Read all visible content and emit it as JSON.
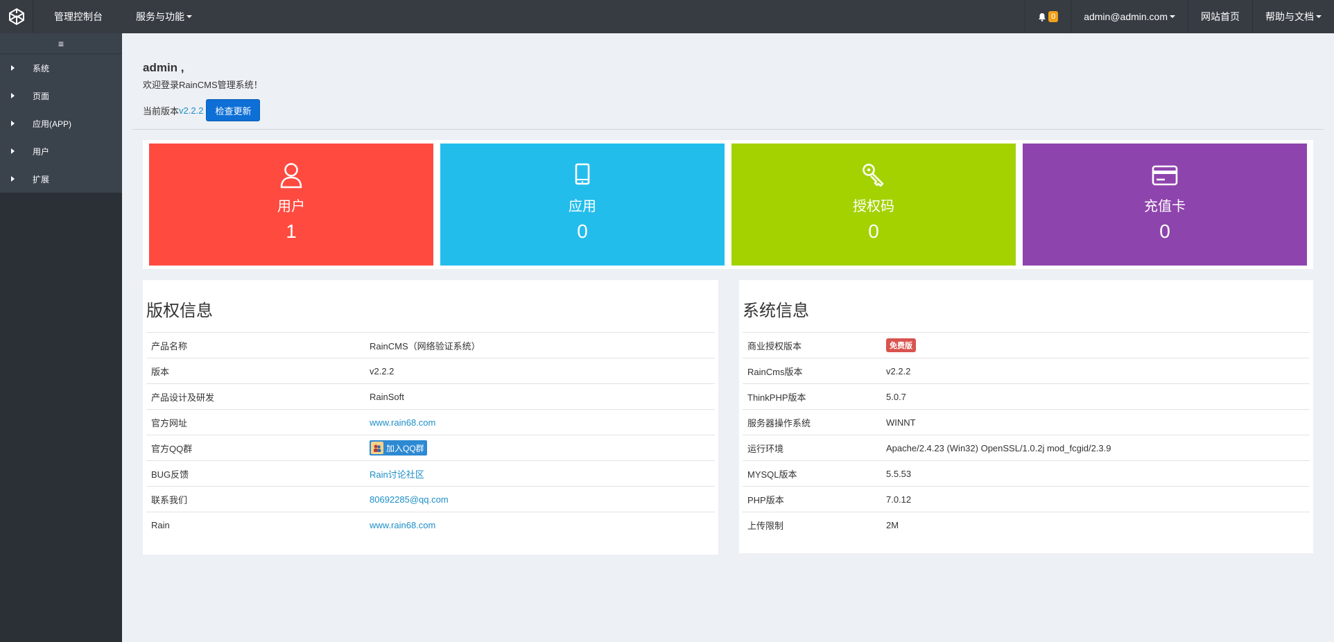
{
  "topbar": {
    "brand": "管理控制台",
    "services": "服务与功能",
    "notification_count": "0",
    "user": "admin@admin.com",
    "home": "网站首页",
    "help": "帮助与文档"
  },
  "sidebar": {
    "toggle_icon": "≡",
    "items": [
      {
        "label": "系统"
      },
      {
        "label": "页面"
      },
      {
        "label": "应用(APP)"
      },
      {
        "label": "用户"
      },
      {
        "label": "扩展"
      }
    ]
  },
  "welcome": {
    "name": "admin ,",
    "message": "欢迎登录RainCMS管理系统！",
    "version_prefix": "当前版本",
    "version": "v2.2.2",
    "check_update": "检查更新"
  },
  "stats": [
    {
      "label": "用户",
      "value": "1",
      "color": "#ff4a40",
      "icon": "user-icon"
    },
    {
      "label": "应用",
      "value": "0",
      "color": "#23bdec",
      "icon": "tablet-icon"
    },
    {
      "label": "授权码",
      "value": "0",
      "color": "#a3d200",
      "icon": "key-icon"
    },
    {
      "label": "充值卡",
      "value": "0",
      "color": "#8e44ad",
      "icon": "card-icon"
    }
  ],
  "copyright": {
    "title": "版权信息",
    "rows": [
      {
        "key": "产品名称",
        "value": "RainCMS（网络验证系统）"
      },
      {
        "key": "版本",
        "value": "v2.2.2"
      },
      {
        "key": "产品设计及研发",
        "value": "RainSoft"
      },
      {
        "key": "官方网址",
        "value": "www.rain68.com"
      },
      {
        "key": "官方QQ群",
        "value": "加入QQ群"
      },
      {
        "key": "BUG反馈",
        "value": "Rain讨论社区"
      },
      {
        "key": "联系我们",
        "value": "80692285@qq.com"
      },
      {
        "key": "Rain",
        "value": "www.rain68.com"
      }
    ]
  },
  "system": {
    "title": "系统信息",
    "rows": [
      {
        "key": "商业授权版本",
        "value": "免费版"
      },
      {
        "key": "RainCms版本",
        "value": "v2.2.2"
      },
      {
        "key": "ThinkPHP版本",
        "value": "5.0.7"
      },
      {
        "key": "服务器操作系统",
        "value": "WINNT"
      },
      {
        "key": "运行环境",
        "value": "Apache/2.4.23 (Win32) OpenSSL/1.0.2j mod_fcgid/2.3.9"
      },
      {
        "key": "MYSQL版本",
        "value": "5.5.53"
      },
      {
        "key": "PHP版本",
        "value": "7.0.12"
      },
      {
        "key": "上传限制",
        "value": "2M"
      }
    ]
  }
}
